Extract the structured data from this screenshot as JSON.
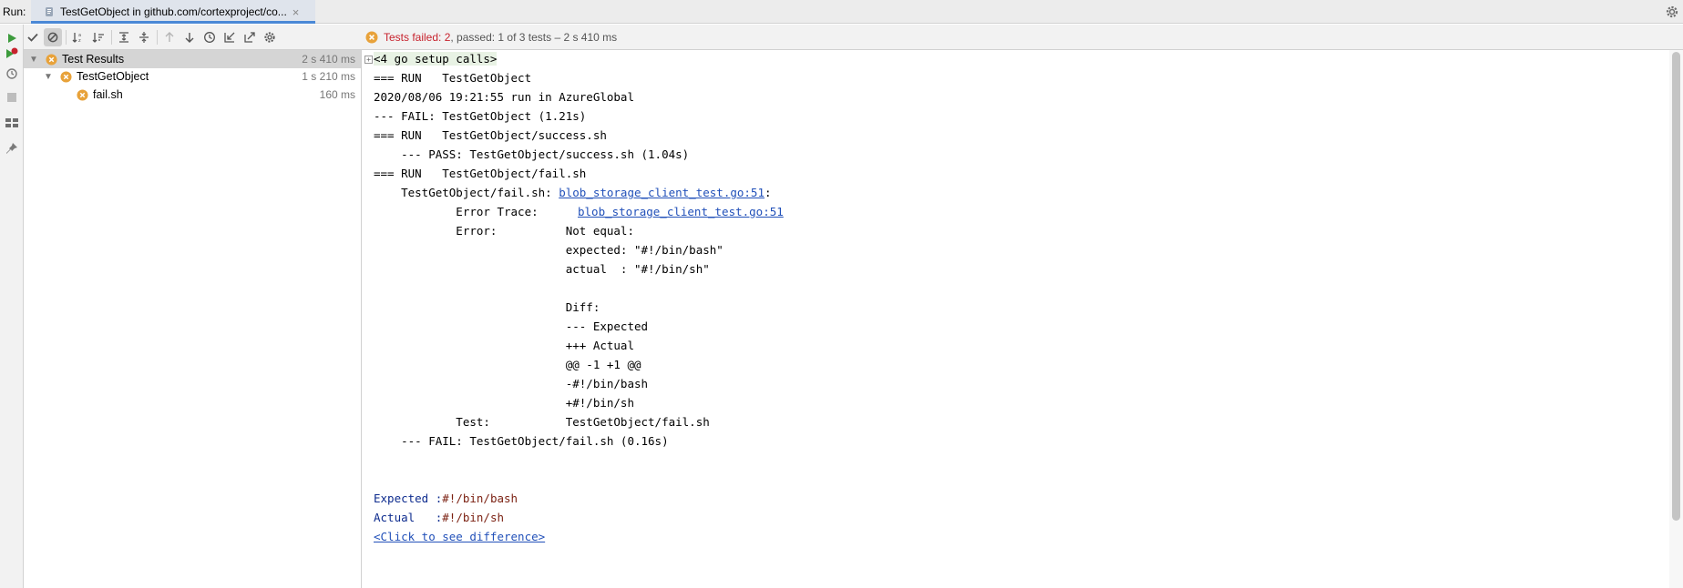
{
  "topbar": {
    "run_label": "Run:",
    "tab_title": "TestGetObject in github.com/cortexproject/co...",
    "tab_icon": "go-test-icon"
  },
  "status": {
    "failed_text": "Tests failed: 2",
    "rest_text": ", passed: 1 of 3 tests – 2 s 410 ms"
  },
  "tree": {
    "items": [
      {
        "label": "Test Results",
        "duration": "2 s 410 ms"
      },
      {
        "label": "TestGetObject",
        "duration": "1 s 210 ms"
      },
      {
        "label": "fail.sh",
        "duration": "160 ms"
      }
    ]
  },
  "console": {
    "setup": "<4 go setup calls>",
    "l1": "=== RUN   TestGetObject",
    "l2": "2020/08/06 19:21:55 run in AzureGlobal",
    "l3": "--- FAIL: TestGetObject (1.21s)",
    "l4": "=== RUN   TestGetObject/success.sh",
    "l5": "    --- PASS: TestGetObject/success.sh (1.04s)",
    "l6": "=== RUN   TestGetObject/fail.sh",
    "l7_prefix": "    TestGetObject/fail.sh: ",
    "l7_link": "blob_storage_client_test.go:51",
    "l7_suffix": ":",
    "l8_prefix": "            Error Trace:\t",
    "l8_link": "blob_storage_client_test.go:51",
    "l9": "            Error:      \tNot equal:",
    "l10": "                        \texpected: \"#!/bin/bash\"",
    "l11": "                        \tactual  : \"#!/bin/sh\"",
    "l12": "                        \tDiff:",
    "l13": "                        \t--- Expected",
    "l14": "                        \t+++ Actual",
    "l15": "                        \t@@ -1 +1 @@",
    "l16": "                        \t-#!/bin/bash",
    "l17": "                        \t+#!/bin/sh",
    "l18": "            Test:       \tTestGetObject/fail.sh",
    "l19": "    --- FAIL: TestGetObject/fail.sh (0.16s)",
    "expected_label": "Expected :",
    "expected_value": "#!/bin/bash",
    "actual_label": "Actual   :",
    "actual_value": "#!/bin/sh",
    "diff_link": "<Click to see difference>"
  },
  "colors": {
    "fail_red": "#c7222d",
    "fail_icon_orange": "#e8a23a",
    "run_green": "#3d9b3d",
    "link_blue": "#2150b9"
  }
}
